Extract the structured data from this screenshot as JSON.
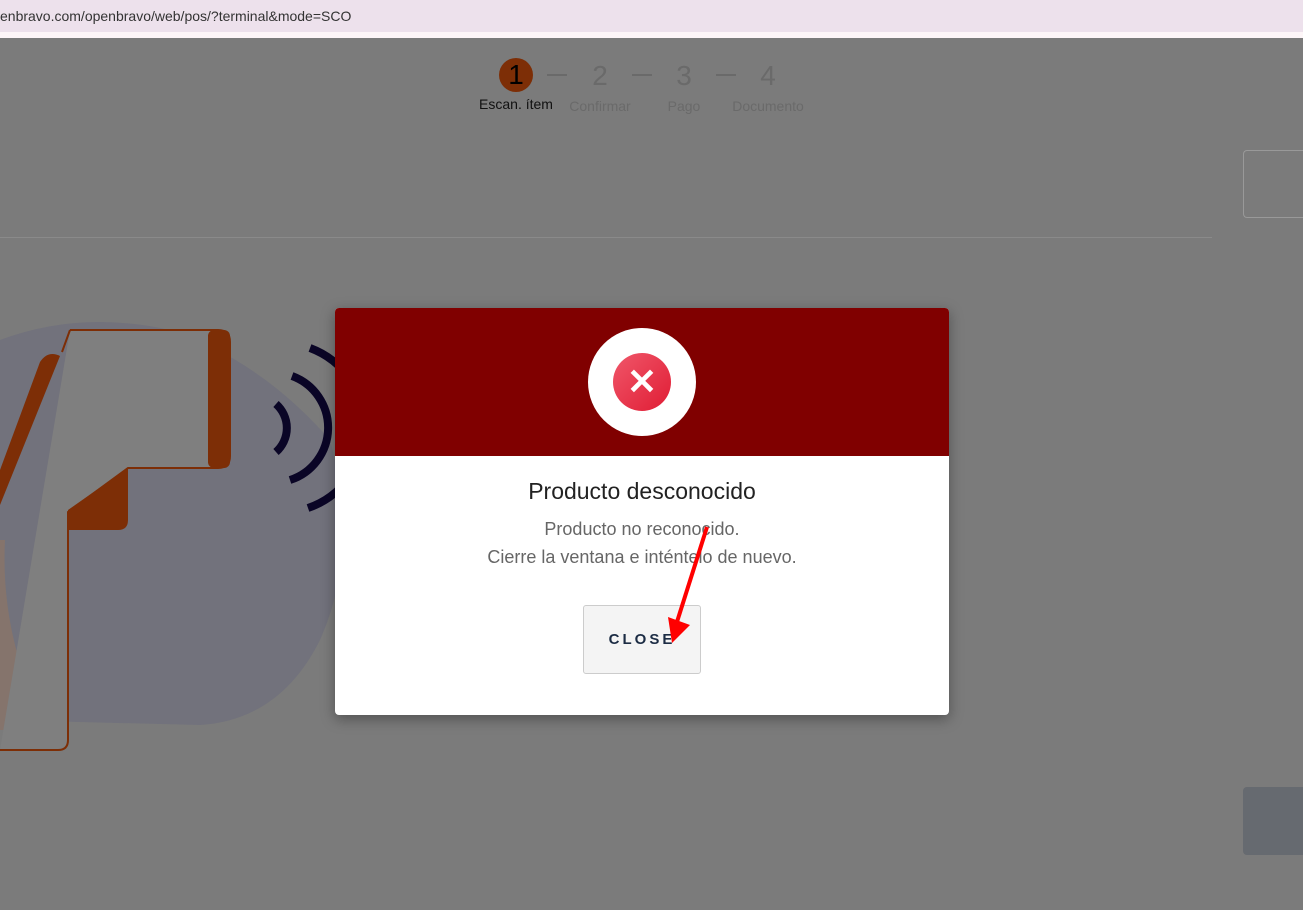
{
  "browser": {
    "url": "enbravo.com/openbravo/web/pos/?terminal&mode=SCO"
  },
  "steps": [
    {
      "num": "1",
      "label": "Escan. ítem"
    },
    {
      "num": "2",
      "label": "Confirmar"
    },
    {
      "num": "3",
      "label": "Pago"
    },
    {
      "num": "4",
      "label": "Documento"
    }
  ],
  "dialog": {
    "icon": "error-x-icon",
    "icon_glyph": "✕",
    "title": "Producto desconocido",
    "line1": "Producto no reconocido.",
    "line2": "Cierre la ventana e inténtelo de nuevo.",
    "close_label": "CLOSE"
  },
  "colors": {
    "header": "#800000",
    "step_active": "#7d2e06",
    "error": "#e01c34"
  }
}
